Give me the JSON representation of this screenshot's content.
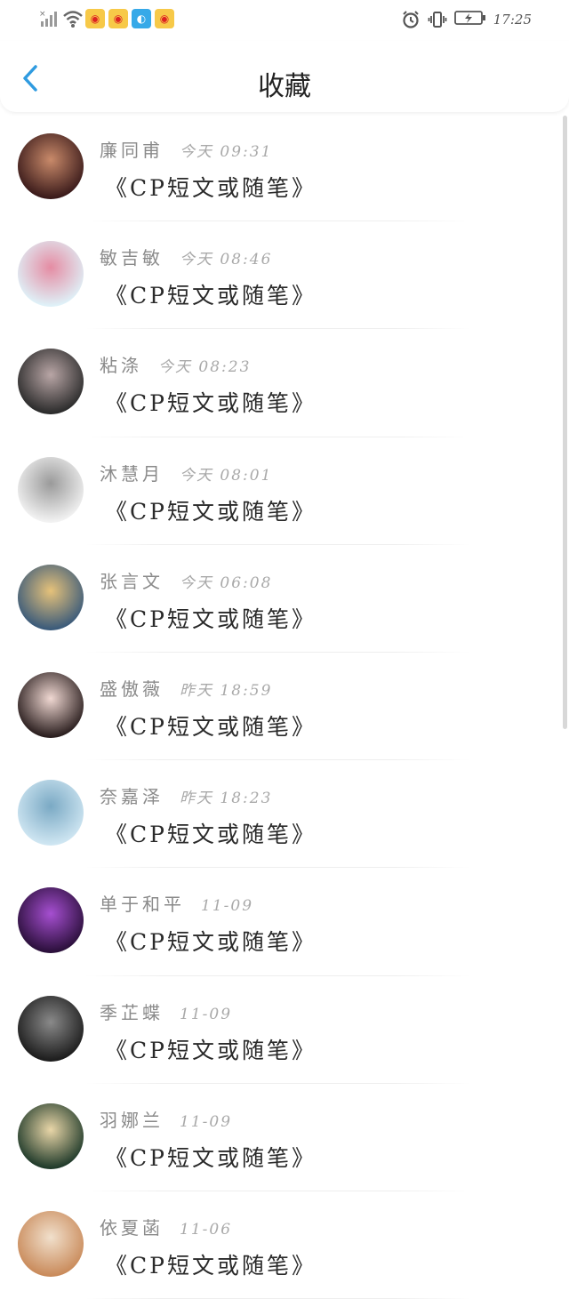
{
  "status_bar": {
    "time": "17:25",
    "icons": [
      "signal-off-icon",
      "wifi-icon",
      "weibo-app-icon",
      "weibo-app-icon",
      "blue-app-icon",
      "weibo-app-icon",
      "alarm-icon",
      "vibrate-icon",
      "battery-charging-icon"
    ]
  },
  "header": {
    "title": "收藏",
    "back_icon": "chevron-left-icon",
    "accent_color": "#2f9be0"
  },
  "list": {
    "items": [
      {
        "name": "廉同甫",
        "time": "今天 09:31",
        "title": "《CP短文或随笔》",
        "avatar_colors": [
          "#3a1a1a",
          "#c98a6a"
        ]
      },
      {
        "name": "敏吉敏",
        "time": "今天 08:46",
        "title": "《CP短文或随笔》",
        "avatar_colors": [
          "#dff1f8",
          "#e58ca3"
        ]
      },
      {
        "name": "粘涤",
        "time": "今天 08:23",
        "title": "《CP短文或随笔》",
        "avatar_colors": [
          "#2b2b2b",
          "#b9a6a6"
        ]
      },
      {
        "name": "沐慧月",
        "time": "今天 08:01",
        "title": "《CP短文或随笔》",
        "avatar_colors": [
          "#f2f2f2",
          "#9a9a9a"
        ]
      },
      {
        "name": "张言文",
        "time": "今天 06:08",
        "title": "《CP短文或随笔》",
        "avatar_colors": [
          "#3a5a7a",
          "#e6c27a"
        ]
      },
      {
        "name": "盛傲薇",
        "time": "昨天 18:59",
        "title": "《CP短文或随笔》",
        "avatar_colors": [
          "#2a1e1e",
          "#f0d8d2"
        ]
      },
      {
        "name": "奈嘉泽",
        "time": "昨天 18:23",
        "title": "《CP短文或随笔》",
        "avatar_colors": [
          "#cfe6f2",
          "#7aa9c4"
        ]
      },
      {
        "name": "单于和平",
        "time": "11-09",
        "title": "《CP短文或随笔》",
        "avatar_colors": [
          "#2a0f3a",
          "#a64fd1"
        ]
      },
      {
        "name": "季芷蝶",
        "time": "11-09",
        "title": "《CP短文或随笔》",
        "avatar_colors": [
          "#1c1c1c",
          "#8a8a8a"
        ]
      },
      {
        "name": "羽娜兰",
        "time": "11-09",
        "title": "《CP短文或随笔》",
        "avatar_colors": [
          "#1f3a2a",
          "#e9d6a8"
        ]
      },
      {
        "name": "依夏菡",
        "time": "11-06",
        "title": "《CP短文或随笔》",
        "avatar_colors": [
          "#c98a5a",
          "#f1e0cc"
        ]
      }
    ]
  }
}
